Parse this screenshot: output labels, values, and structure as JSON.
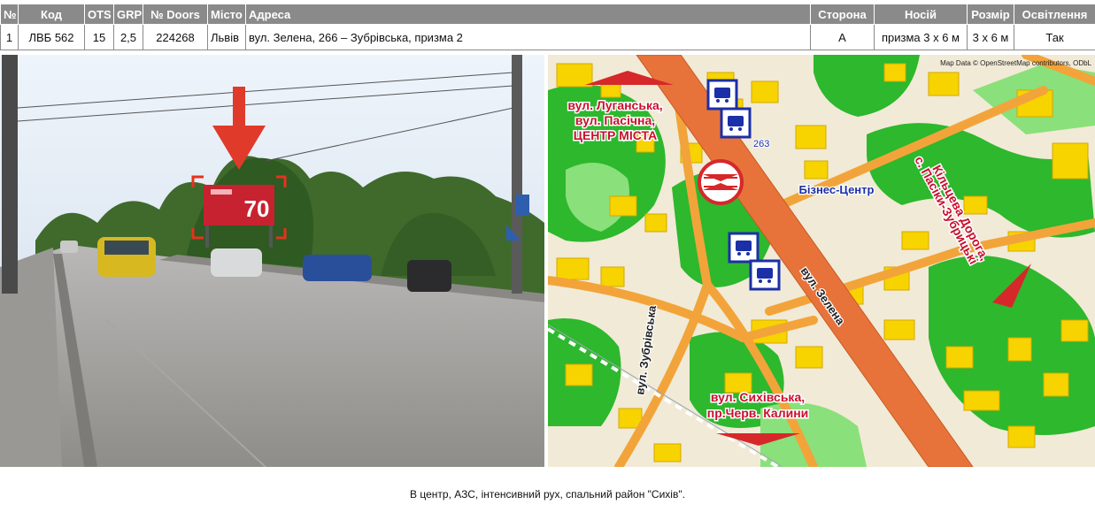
{
  "table": {
    "headers": [
      "№",
      "Код",
      "OTS",
      "GRP",
      "№ Doors",
      "Місто",
      "Адреса",
      "Сторона",
      "Носій",
      "Розмір",
      "Освітлення"
    ],
    "row": [
      "1",
      "ЛВБ 562",
      "15",
      "2,5",
      "224268",
      "Львів",
      "вул. Зелена, 266 – Зубрівська, призма 2",
      "А",
      "призма 3 х 6 м",
      "3 х 6 м",
      "Так"
    ]
  },
  "photo": {
    "billboard_text": "70"
  },
  "map": {
    "credit": "Map Data © OpenStreetMap contributors, ODbL",
    "label_top": [
      "вул. Луганська,",
      "вул. Пасічна,",
      "ЦЕНТР МІСТА"
    ],
    "label_bottom": [
      "вул. Сихівська,",
      "пр.Черв. Калини"
    ],
    "label_right": [
      "Кільцева Дорога,",
      "с. Пасіки-Зубрицькі"
    ],
    "business_center": "Бізнес-Центр",
    "street_zelena": "вул. Зелена",
    "street_zubrivska": "вул. Зубрівська",
    "route_number": "263",
    "colors": {
      "road_main": "#e8733a",
      "road_minor": "#f2a43a",
      "building": "#f7d300",
      "park": "#2db82d",
      "arrow": "#d6282a",
      "label": "#c8102e",
      "bus": "#1b2fa8"
    }
  },
  "caption": "В центр, АЗС, інтенсивний рух, спальний район \"Сихів\"."
}
